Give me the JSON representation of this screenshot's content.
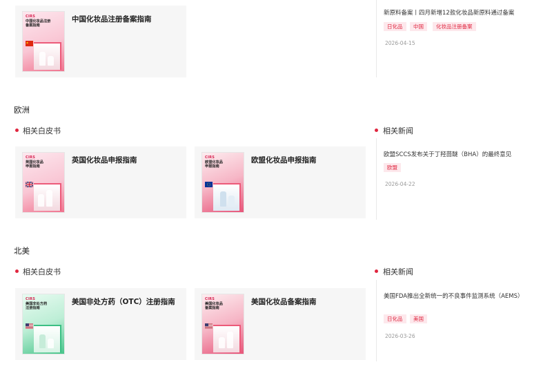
{
  "top": {
    "card": {
      "title": "中国化妆品注册备案指南",
      "cover_title": "中国化妆品注册\n备案指南"
    },
    "news": {
      "title": "新原料备案丨四月新增12款化妆品新原料通过备案",
      "tags": [
        "日化品",
        "中国",
        "化妆品注册备案"
      ],
      "date": "2026-04-15"
    }
  },
  "brand": "CIRS",
  "europe": {
    "region": "欧洲",
    "whitepaper_label": "相关白皮书",
    "news_label": "相关新闻",
    "cards": [
      {
        "title": "英国化妆品申报指南",
        "cover_title": "英国化妆品\n申报指南"
      },
      {
        "title": "欧盟化妆品申报指南",
        "cover_title": "欧盟化妆品\n申报指南"
      }
    ],
    "news": {
      "title": "欧盟SCCS发布关于丁羟茴醚（BHA）的最终意见",
      "tags": [
        "欧盟"
      ],
      "date": "2026-04-22"
    }
  },
  "north_america": {
    "region": "北美",
    "whitepaper_label": "相关白皮书",
    "news_label": "相关新闻",
    "cards": [
      {
        "title": "美国非处方药（OTC）注册指南",
        "cover_title": "美国非处方药\n注册指南"
      },
      {
        "title": "美国化妆品备案指南",
        "cover_title": "美国化妆品\n备案指南"
      }
    ],
    "news": {
      "title": "美国FDA推出全新统一的不良事件监测系统（AEMS）",
      "tags": [
        "日化品",
        "美国"
      ],
      "date": "2026-03-26"
    }
  },
  "colors": {
    "accent": "#e0263f",
    "tag_bg": "#fde8ec",
    "card_bg": "#f6f6f6"
  }
}
